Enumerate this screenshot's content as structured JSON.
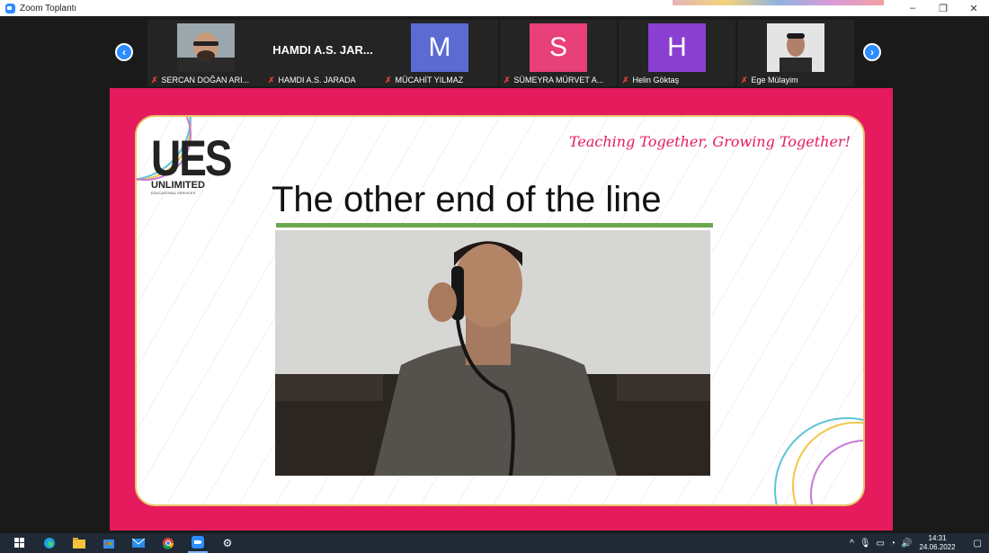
{
  "window": {
    "title": "Zoom Toplantı",
    "minimize": "–",
    "restore": "❐",
    "close": "✕"
  },
  "participants": [
    {
      "name": "SERCAN DOĞAN ARI...",
      "type": "photo"
    },
    {
      "name": "HAMDI A.S. JARADA",
      "display": "HAMDI A.S. JAR...",
      "type": "name"
    },
    {
      "name": "MÜCAHİT YILMAZ",
      "initial": "M",
      "color": "#5b6bd1",
      "type": "initial"
    },
    {
      "name": "SÜMEYRA MÜRVET A...",
      "initial": "S",
      "color": "#e8407a",
      "type": "initial"
    },
    {
      "name": "Helin Göktaş",
      "initial": "H",
      "color": "#8a3fd1",
      "type": "initial"
    },
    {
      "name": "Ege Mülayim",
      "type": "photo"
    }
  ],
  "nav": {
    "prev": "‹",
    "next": "›"
  },
  "slide": {
    "logo": "UES",
    "logo_line": "UNLIMITED",
    "logo_sub": "EDUCATIONAL SERVICES",
    "tagline": "Teaching Together, Growing Together!",
    "title": "The other end of the line"
  },
  "taskbar": {
    "time": "14:31",
    "date": "24.06.2022"
  },
  "colors": {
    "accent": "#2d8cff",
    "slide_border": "#e51b5e",
    "underline": "#6aa84f"
  }
}
